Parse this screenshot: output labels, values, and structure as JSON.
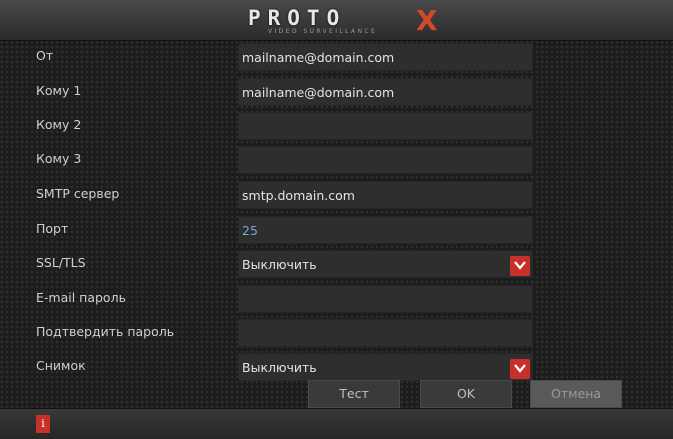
{
  "logo": {
    "name": "PROTO",
    "sub": "VIDEO SURVEILLANCE",
    "mark": "X"
  },
  "form": {
    "rows": [
      {
        "label": "От",
        "value": "mailname@domain.com"
      },
      {
        "label": "Кому 1",
        "value": "mailname@domain.com"
      },
      {
        "label": "Кому 2",
        "value": ""
      },
      {
        "label": "Кому 3",
        "value": ""
      },
      {
        "label": "SMTP сервер",
        "value": "smtp.domain.com"
      },
      {
        "label": "Порт",
        "value": "25"
      },
      {
        "label": "SSL/TLS",
        "value": "Выключить"
      },
      {
        "label": "E-mail пароль",
        "value": ""
      },
      {
        "label": "Подтвердить пароль",
        "value": ""
      },
      {
        "label": "Снимок",
        "value": "Выключить"
      }
    ]
  },
  "buttons": {
    "test": "Тест",
    "ok": "OK",
    "cancel": "Отмена"
  },
  "status": {
    "info_icon": "i"
  },
  "colors": {
    "accent": "#c8302a",
    "port_value": "#7da7d6"
  }
}
